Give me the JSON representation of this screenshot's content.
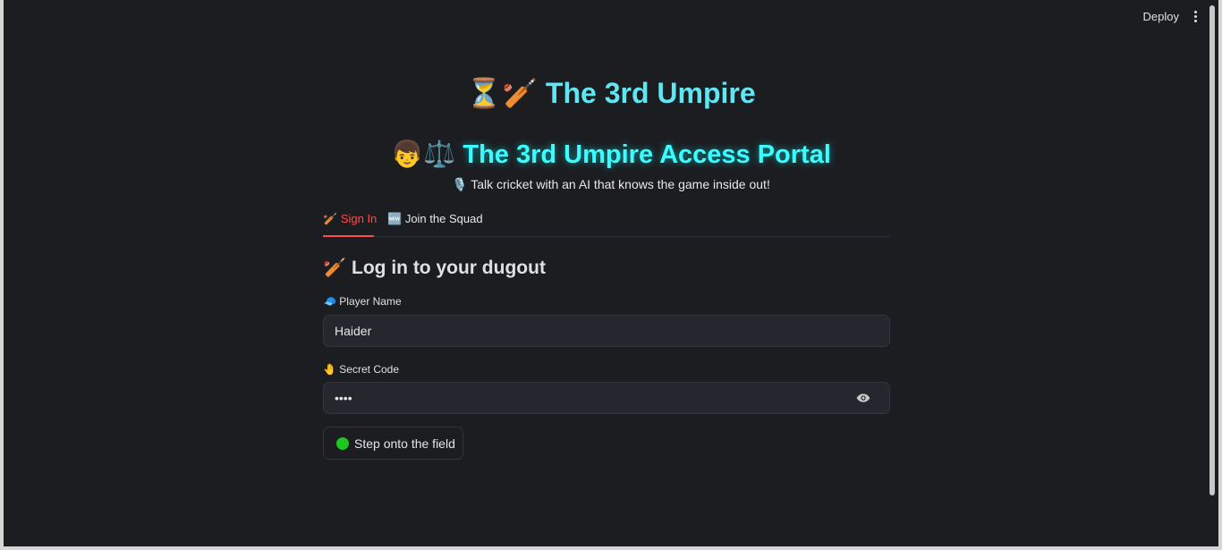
{
  "topbar": {
    "deploy_label": "Deploy",
    "menu_icon": "more-vertical-icon"
  },
  "header": {
    "title_emoji": "⏳🏏",
    "title_text": "The 3rd Umpire",
    "portal_emoji": "👦⚖️",
    "portal_text": "The 3rd Umpire Access Portal",
    "subtitle_emoji": "🎙️",
    "subtitle_text": "Talk cricket with an AI that knows the game inside out!"
  },
  "tabs": [
    {
      "emoji": "🏏",
      "label": "Sign In",
      "active": true
    },
    {
      "emoji": "🆕",
      "label": "Join the Squad",
      "active": false
    }
  ],
  "form": {
    "heading_emoji": "🏏",
    "heading_text": "Log in to your dugout",
    "player_label_emoji": "🧢",
    "player_label": "Player Name",
    "player_value": "Haider",
    "secret_label_emoji": "🤚",
    "secret_label": "Secret Code",
    "secret_value": "••••",
    "submit_label": "Step onto the field"
  },
  "colors": {
    "background": "#1c1d21",
    "title": "#5ee7f2",
    "portal_title": "#3dfcff",
    "active_tab": "#ff4b4b",
    "button_dot": "#1fc61f"
  }
}
